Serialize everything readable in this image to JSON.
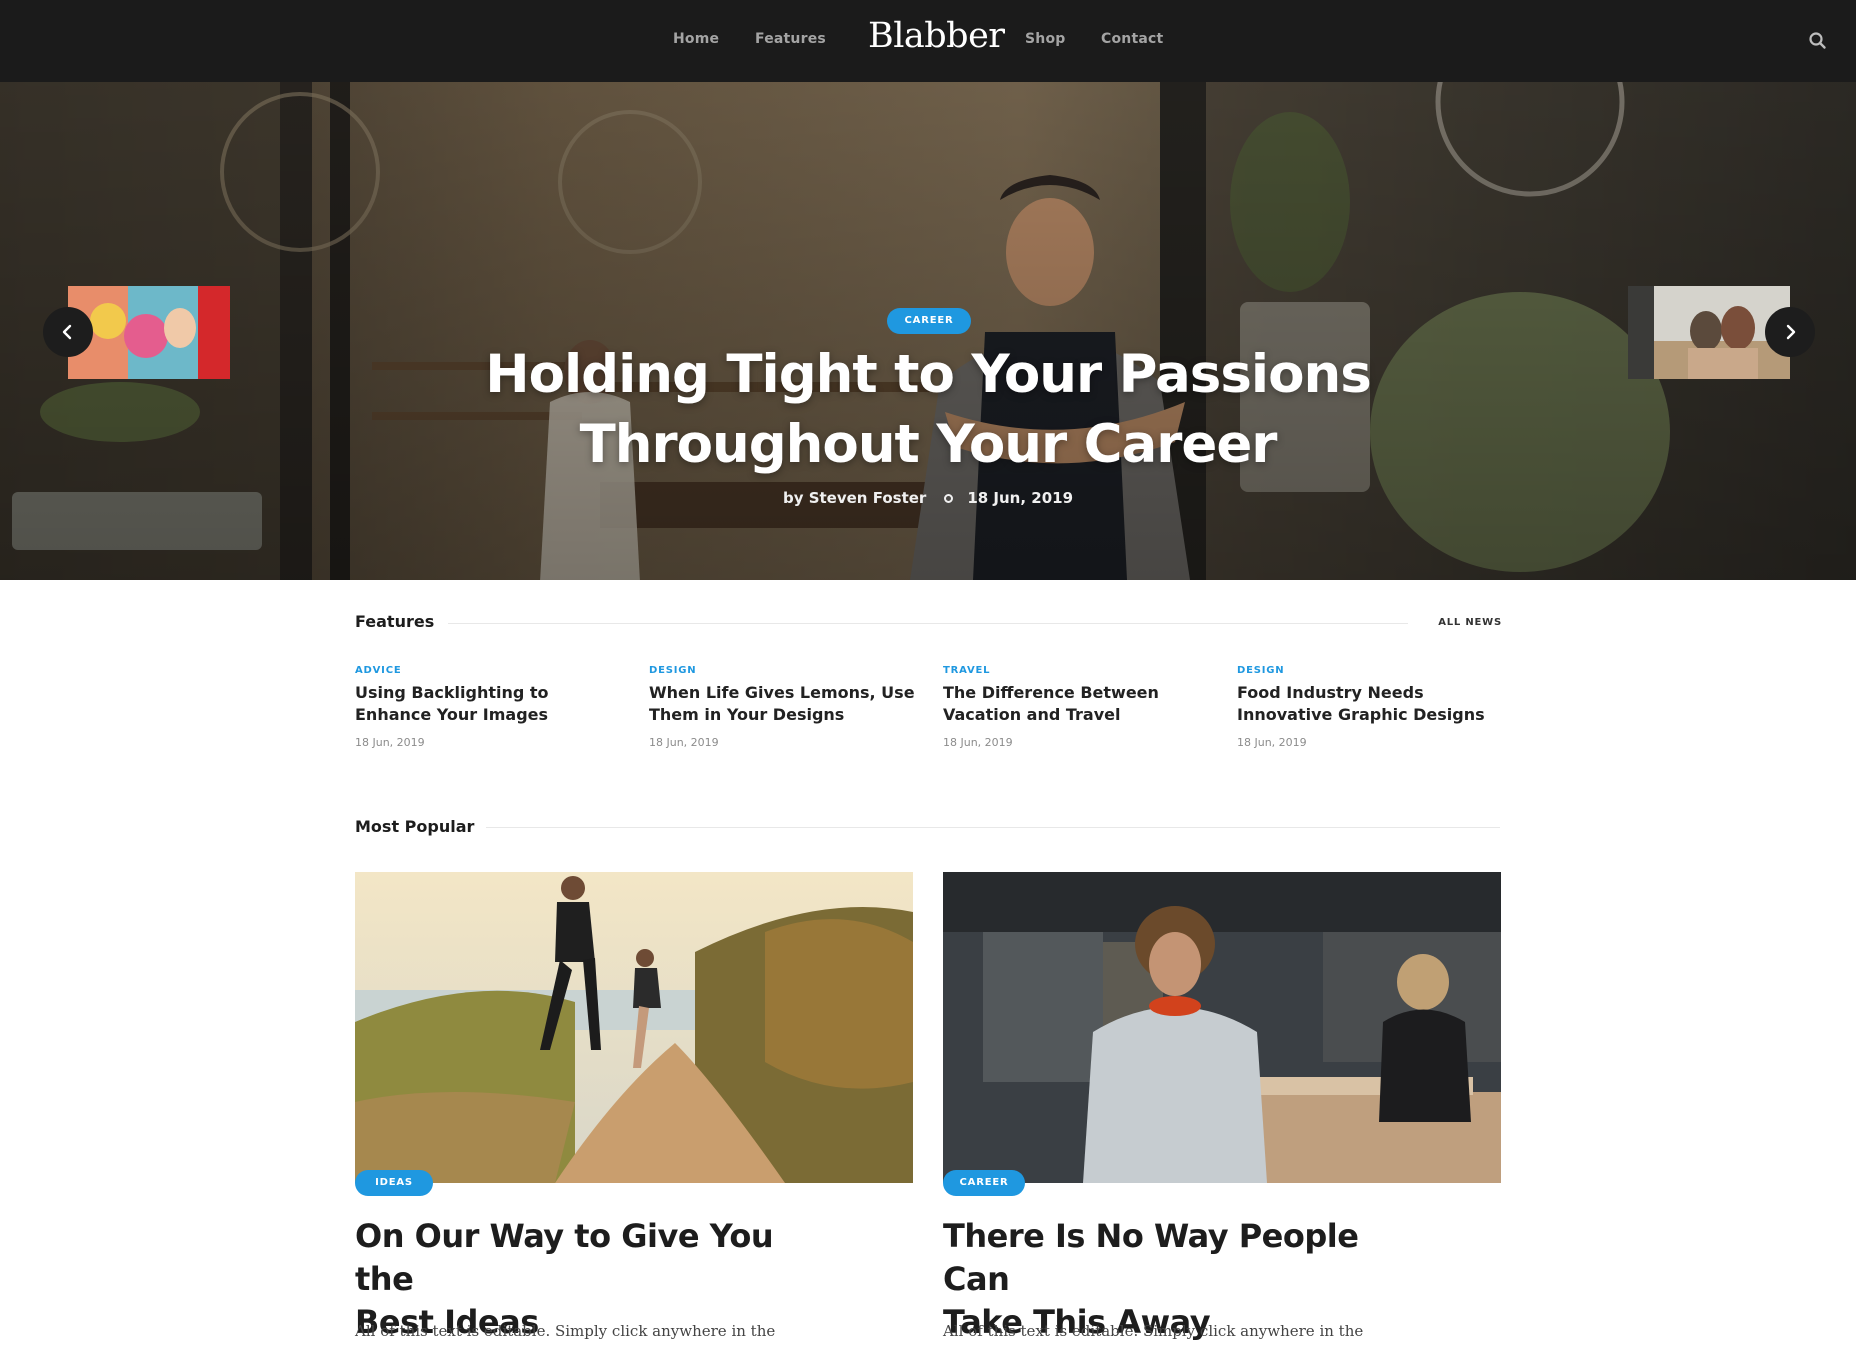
{
  "nav": {
    "links_left": [
      "Home",
      "Features"
    ],
    "logo": "Blabber",
    "links_right": [
      "Shop",
      "Contact"
    ],
    "search_icon": "search-icon"
  },
  "hero": {
    "badge": "CAREER",
    "title_line1": "Holding Tight to Your Passions",
    "title_line2": "Throughout Your Career",
    "author": "by Steven Foster",
    "date": "18 Jun, 2019",
    "prev_icon": "chevron-left-icon",
    "next_icon": "chevron-right-icon"
  },
  "features": {
    "title": "Features",
    "all_news": "ALL NEWS",
    "items": [
      {
        "category": "ADVICE",
        "title_line1": "Using Backlighting to",
        "title_line2": "Enhance Your Images",
        "date": "18 Jun, 2019"
      },
      {
        "category": "DESIGN",
        "title_line1": "When Life Gives Lemons, Use",
        "title_line2": "Them in Your Designs",
        "date": "18 Jun, 2019"
      },
      {
        "category": "TRAVEL",
        "title_line1": "The Difference Between",
        "title_line2": "Vacation and Travel",
        "date": "18 Jun, 2019"
      },
      {
        "category": "DESIGN",
        "title_line1": "Food Industry Needs",
        "title_line2": "Innovative Graphic Designs",
        "date": "18 Jun, 2019"
      }
    ]
  },
  "popular": {
    "title": "Most Popular",
    "cards": [
      {
        "badge": "IDEAS",
        "title_line1": "On Our Way to Give You the",
        "title_line2": "Best Ideas",
        "excerpt": "All of this text is editable. Simply click anywhere in the"
      },
      {
        "badge": "CAREER",
        "title_line1": "There Is No Way People Can",
        "title_line2": "Take This Away",
        "excerpt": "All of this text is editable. Simply click anywhere in the"
      }
    ]
  },
  "colors": {
    "accent": "#1f98e0",
    "nav_bg": "#1b1b1b",
    "text_dark": "#1d1d1d"
  }
}
